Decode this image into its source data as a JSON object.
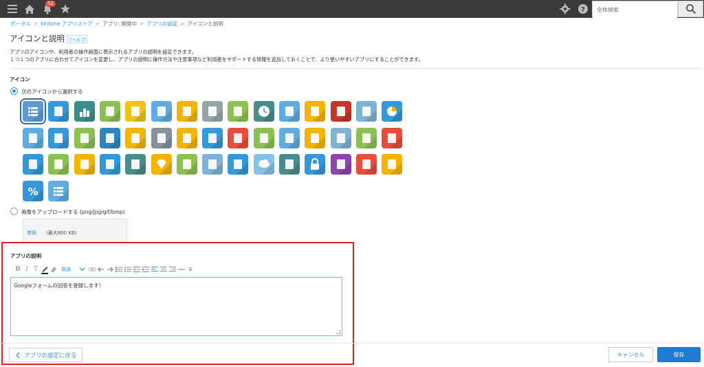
{
  "topbar": {
    "notification_count": "52",
    "search_placeholder": "全体検索"
  },
  "breadcrumb": [
    "ポータル",
    "kintone アプリストア",
    "アプリ: 開発中",
    "アプリの設定",
    "アイコンと説明"
  ],
  "page": {
    "title": "アイコンと説明",
    "help": "?ヘルプ",
    "desc_line1": "アプリのアイコンや、利用者の操作画面に表示されるアプリの説明を設定できます。",
    "desc_line2": "１つ１つのアプリに合わせてアイコンを変更し、アプリの説明に操作方法や注意事項など利用者をサポートする情報を追加しておくことで、より使いやすいアプリにすることができます。"
  },
  "icon_section": {
    "label": "アイコン",
    "option_select": "次のアイコンから選択する",
    "option_upload": "画像をアップロードする (png/jpg/gif/bmp)",
    "browse": "参照",
    "max_size": "(最大800 KB)"
  },
  "description_section": {
    "label": "アプリの説明",
    "toolbar_font_size": "普通",
    "content": "Googleフォームの回答を登録します！"
  },
  "buttons": {
    "back": "アプリの設定に戻る",
    "cancel": "キャンセル",
    "save": "保存"
  },
  "icon_grid": [
    [
      "list-icon",
      "#5b9bd5"
    ],
    [
      "document-icon",
      "#3498db"
    ],
    [
      "bar-chart-icon",
      "#3d8c8c"
    ],
    [
      "laptop-icon",
      "#8cc152"
    ],
    [
      "lightbulb-head-icon",
      "#f1c40f"
    ],
    [
      "spreadsheet-icon",
      "#5dade2"
    ],
    [
      "clipboard-icon",
      "#f4b400"
    ],
    [
      "printer-icon",
      "#95a5a6"
    ],
    [
      "books-icon",
      "#8cc152"
    ],
    [
      "clock-icon",
      "#4a8c8c"
    ],
    [
      "folder-icon",
      "#5dade2"
    ],
    [
      "id-card-icon",
      "#f4b400"
    ],
    [
      "envelope-icon",
      "#c0392b"
    ],
    [
      "mail-icon",
      "#7fb3d5"
    ],
    [
      "pie-chart-icon",
      "#3498db"
    ],
    [
      "monitor-icon",
      "#5dade2"
    ],
    [
      "coffee-icon",
      "#3498db"
    ],
    [
      "pushpin-icon",
      "#8cc152"
    ],
    [
      "paperclip-icon",
      "#2e86c1"
    ],
    [
      "smartphone-icon",
      "#f4b400"
    ],
    [
      "calculator-icon",
      "#85929e"
    ],
    [
      "briefcase-icon",
      "#f4b400"
    ],
    [
      "calendar-icon",
      "#3498db"
    ],
    [
      "megaphone-icon",
      "#e74c3c"
    ],
    [
      "pencil-icon",
      "#8cc152"
    ],
    [
      "mouse-icon",
      "#5dade2"
    ],
    [
      "bulb-icon",
      "#f4b400"
    ],
    [
      "chair-icon",
      "#7fb3d5"
    ],
    [
      "wallet-icon",
      "#8cc152"
    ],
    [
      "piggy-bank-icon",
      "#e74c3c"
    ],
    [
      "credit-card-icon",
      "#3498db"
    ],
    [
      "hand-pen-icon",
      "#8cc152"
    ],
    [
      "glasses-icon",
      "#f4b400"
    ],
    [
      "abacus-icon",
      "#3498db"
    ],
    [
      "safe-icon",
      "#4a8c8c"
    ],
    [
      "diamond-icon",
      "#f4b400"
    ],
    [
      "chat-icon",
      "#8cc152"
    ],
    [
      "speech-icon",
      "#7fb3d5"
    ],
    [
      "wrench-icon",
      "#3498db"
    ],
    [
      "cloud-icon",
      "#85c1e9"
    ],
    [
      "gears-icon",
      "#4a8c8c"
    ],
    [
      "lock-icon",
      "#3498db"
    ],
    [
      "atom-icon",
      "#8e44ad"
    ],
    [
      "flask-icon",
      "#e74c3c"
    ],
    [
      "gas-pump-icon",
      "#f4b400"
    ],
    [
      "percent-icon",
      "#3498db"
    ],
    [
      "list-alt-icon",
      "#5dade2"
    ]
  ]
}
